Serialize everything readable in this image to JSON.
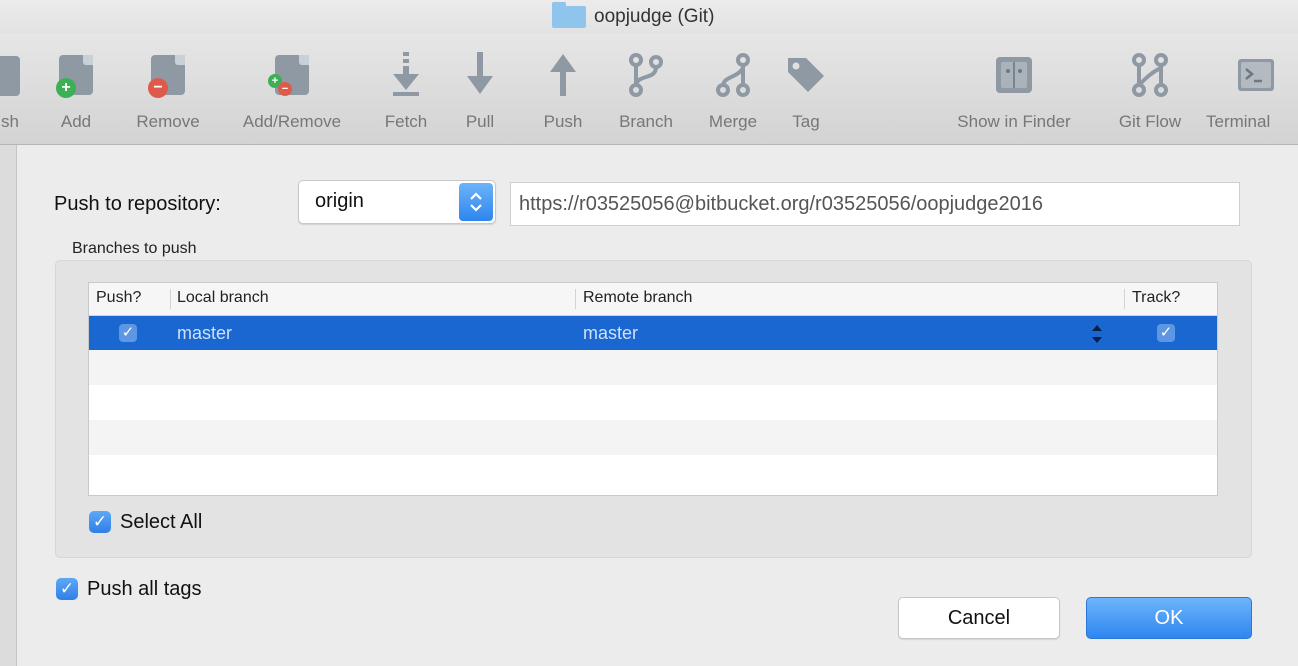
{
  "window": {
    "title": "oopjudge (Git)"
  },
  "toolbar": {
    "items": [
      {
        "label": "sh",
        "icon": "commit-icon"
      },
      {
        "label": "Add",
        "icon": "add-file-icon"
      },
      {
        "label": "Remove",
        "icon": "remove-file-icon"
      },
      {
        "label": "Add/Remove",
        "icon": "add-remove-icon"
      },
      {
        "label": "Fetch",
        "icon": "fetch-icon"
      },
      {
        "label": "Pull",
        "icon": "pull-icon"
      },
      {
        "label": "Push",
        "icon": "push-icon"
      },
      {
        "label": "Branch",
        "icon": "branch-icon"
      },
      {
        "label": "Merge",
        "icon": "merge-icon"
      },
      {
        "label": "Tag",
        "icon": "tag-icon"
      },
      {
        "label": "Show in Finder",
        "icon": "finder-icon"
      },
      {
        "label": "Git Flow",
        "icon": "git-flow-icon"
      },
      {
        "label": "Terminal",
        "icon": "terminal-icon"
      }
    ]
  },
  "dialog": {
    "repo_label": "Push to repository:",
    "repo_selected": "origin",
    "repo_url": "https://r03525056@bitbucket.org/r03525056/oopjudge2016",
    "branches_label": "Branches to push",
    "columns": {
      "push": "Push?",
      "local": "Local branch",
      "remote": "Remote branch",
      "track": "Track?"
    },
    "rows": [
      {
        "push": true,
        "local": "master",
        "remote": "master",
        "track": true
      }
    ],
    "select_all_label": "Select All",
    "push_tags_label": "Push all tags",
    "cancel_label": "Cancel",
    "ok_label": "OK"
  },
  "colors": {
    "accent": "#2f7fe6",
    "selection": "#1a67d1"
  }
}
